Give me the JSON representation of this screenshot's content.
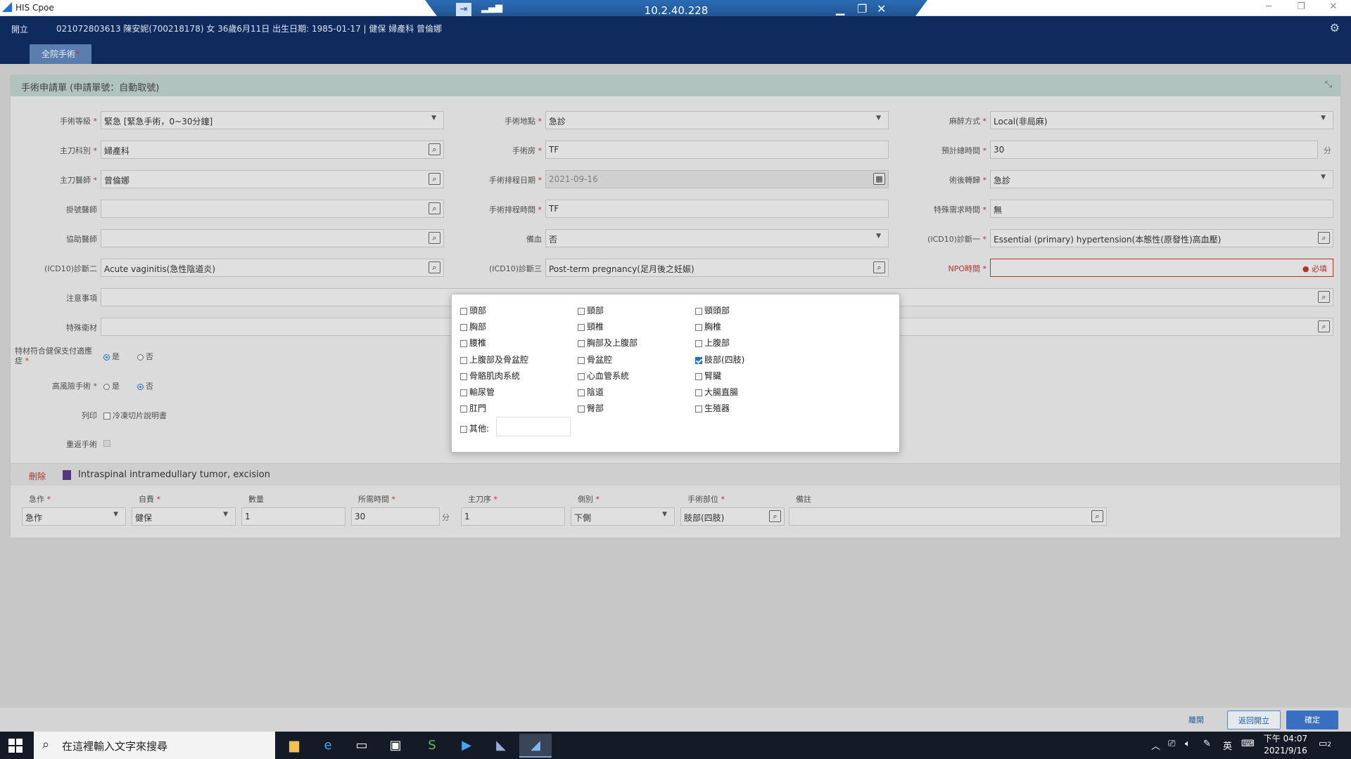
{
  "window": {
    "title": "HIS Cpoe"
  },
  "rdp": {
    "ip": "10.2.40.228"
  },
  "header": {
    "back_label": "開立",
    "patient_info": "021072803613 陳安妮(700218178) 女 36歲6月11日 出生日期: 1985-01-17 | 健保 婦產科 曾倫娜",
    "tab_label": "全院手術",
    "tab_required": "*"
  },
  "form": {
    "title": "手術申請單 (申請單號：自動取號)",
    "required_mark": "*",
    "fields": {
      "surgery_level": {
        "label": "手術等級",
        "value": "緊急 [緊急手術，0~30分鐘]"
      },
      "surgery_location": {
        "label": "手術地點",
        "value": "急診"
      },
      "anesthesia": {
        "label": "麻醉方式",
        "value": "Local(非局麻)"
      },
      "main_dept": {
        "label": "主刀科別",
        "value": "婦產科"
      },
      "surgery_room": {
        "label": "手術房",
        "value": "TF"
      },
      "est_time": {
        "label": "預計總時間",
        "value": "30",
        "unit": "分"
      },
      "main_doctor": {
        "label": "主刀醫師",
        "value": "曾倫娜"
      },
      "schedule_date": {
        "label": "手術排程日期",
        "value": "2021-09-16"
      },
      "post_op_transfer": {
        "label": "術後轉歸",
        "value": "急診"
      },
      "assist_doctor": {
        "label": "掛號醫師",
        "value": ""
      },
      "schedule_time": {
        "label": "手術排程時間",
        "value": "TF"
      },
      "special_time": {
        "label": "特殊需求時間",
        "value": "無"
      },
      "assist_doctor2": {
        "label": "協助醫師",
        "value": ""
      },
      "blood": {
        "label": "備血",
        "value": "否"
      },
      "icd10_1": {
        "label": "(ICD10)診斷一",
        "value": "Essential (primary) hypertension(本態性(原發性)高血壓)"
      },
      "icd10_2": {
        "label": "(ICD10)診斷二",
        "value": "Acute vaginitis(急性陰道炎)"
      },
      "icd10_3": {
        "label": "(ICD10)診斷三",
        "value": "Post-term pregnancy(足月後之妊娠)"
      },
      "npo_time": {
        "label": "NPO時間",
        "value": "",
        "error": "必填"
      },
      "notes": {
        "label": "注意事項",
        "value": ""
      },
      "special_material": {
        "label": "特殊衛材",
        "value": ""
      },
      "insurance_payment": {
        "label": "特材符合健保支付適應症",
        "options": [
          "是",
          "否"
        ],
        "selected": "是"
      },
      "high_risk": {
        "label": "高風險手術",
        "options": [
          "是",
          "否"
        ],
        "selected": "否"
      },
      "print": {
        "label": "列印",
        "checkbox_label": "冷凍切片說明書",
        "checked": false
      },
      "repeat_surgery": {
        "label": "重返手術",
        "checked": false
      }
    }
  },
  "procedure": {
    "delete_label": "刪除",
    "name": "Intraspinal intramedullary tumor, excision",
    "columns": [
      "急作",
      "自費",
      "數量",
      "所需時間",
      "主刀序",
      "側別",
      "手術部位",
      "備註"
    ],
    "columns_required": [
      true,
      true,
      false,
      true,
      true,
      true,
      true,
      false
    ],
    "values": {
      "urgent": "急作",
      "payment": "健保",
      "quantity": "1",
      "time": "30",
      "time_unit": "分",
      "main_order": "1",
      "side": "下側",
      "site": "肢部(四肢)",
      "note": ""
    }
  },
  "modal": {
    "options": [
      {
        "label": "頭部",
        "checked": false
      },
      {
        "label": "頸部",
        "checked": false
      },
      {
        "label": "頸頭部",
        "checked": false
      },
      {
        "label": "胸部",
        "checked": false
      },
      {
        "label": "頸椎",
        "checked": false
      },
      {
        "label": "胸椎",
        "checked": false
      },
      {
        "label": "腰椎",
        "checked": false
      },
      {
        "label": "胸部及上腹部",
        "checked": false
      },
      {
        "label": "上腹部",
        "checked": false
      },
      {
        "label": "上腹部及骨盆腔",
        "checked": false
      },
      {
        "label": "骨盆腔",
        "checked": false
      },
      {
        "label": "肢部(四肢)",
        "checked": true
      },
      {
        "label": "骨骼肌肉系統",
        "checked": false
      },
      {
        "label": "心血管系統",
        "checked": false
      },
      {
        "label": "腎臟",
        "checked": false
      },
      {
        "label": "輸尿管",
        "checked": false
      },
      {
        "label": "陰道",
        "checked": false
      },
      {
        "label": "大腸直腸",
        "checked": false
      },
      {
        "label": "肛門",
        "checked": false
      },
      {
        "label": "臀部",
        "checked": false
      },
      {
        "label": "生殖器",
        "checked": false
      }
    ],
    "other_label": "其他:",
    "other_value": ""
  },
  "footer": {
    "cancel": "離開",
    "back": "返回開立",
    "confirm": "確定"
  },
  "taskbar": {
    "search_placeholder": "在這裡輸入文字來搜尋",
    "ime": "英",
    "time": "下午 04:07",
    "date": "2021/9/16",
    "notification_count": "2"
  }
}
